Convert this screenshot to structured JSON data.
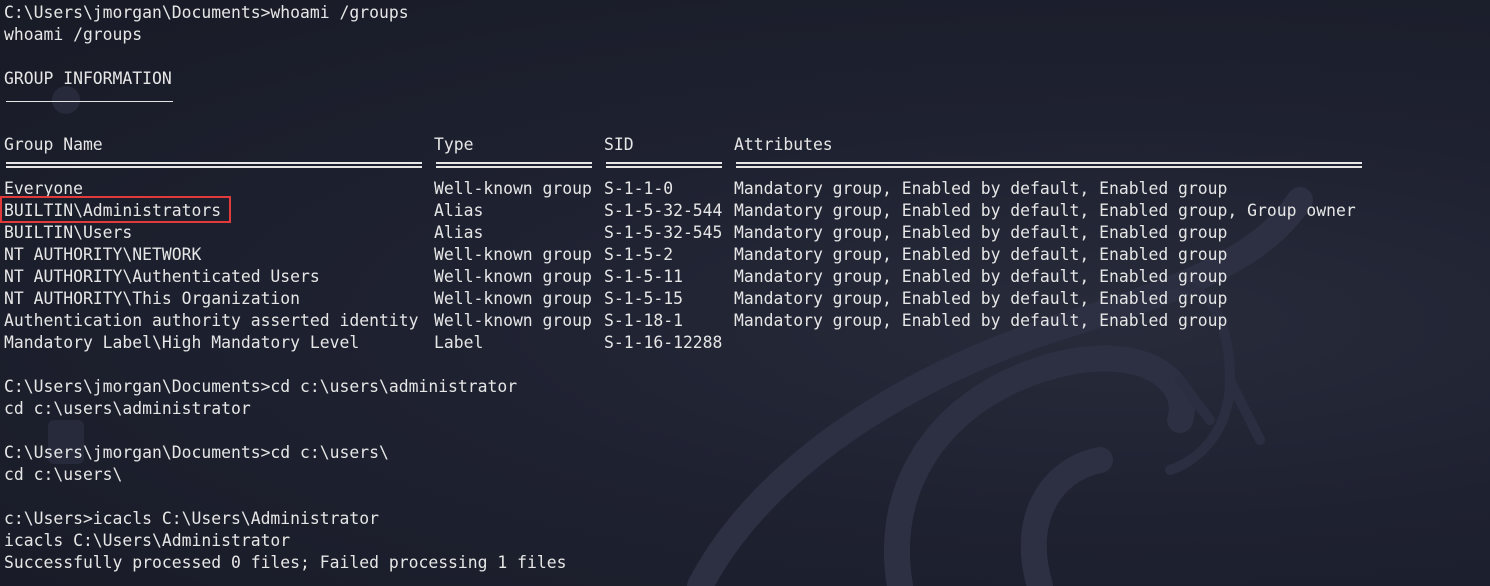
{
  "session": {
    "line1": "C:\\Users\\jmorgan\\Documents>whoami /groups",
    "line2": "whoami /groups",
    "section_title": "GROUP INFORMATION"
  },
  "table": {
    "headers": [
      "Group Name",
      "Type",
      "SID",
      "Attributes"
    ],
    "rows": [
      [
        "Everyone",
        "Well-known group",
        "S-1-1-0",
        "Mandatory group, Enabled by default, Enabled group"
      ],
      [
        "BUILTIN\\Administrators",
        "Alias",
        "S-1-5-32-544",
        "Mandatory group, Enabled by default, Enabled group, Group owner"
      ],
      [
        "BUILTIN\\Users",
        "Alias",
        "S-1-5-32-545",
        "Mandatory group, Enabled by default, Enabled group"
      ],
      [
        "NT AUTHORITY\\NETWORK",
        "Well-known group",
        "S-1-5-2",
        "Mandatory group, Enabled by default, Enabled group"
      ],
      [
        "NT AUTHORITY\\Authenticated Users",
        "Well-known group",
        "S-1-5-11",
        "Mandatory group, Enabled by default, Enabled group"
      ],
      [
        "NT AUTHORITY\\This Organization",
        "Well-known group",
        "S-1-5-15",
        "Mandatory group, Enabled by default, Enabled group"
      ],
      [
        "Authentication authority asserted identity",
        "Well-known group",
        "S-1-18-1",
        "Mandatory group, Enabled by default, Enabled group"
      ],
      [
        "Mandatory Label\\High Mandatory Level",
        "Label",
        "S-1-16-12288",
        ""
      ]
    ],
    "highlighted_row": 1
  },
  "commands": {
    "cd_admin_prompt": "C:\\Users\\jmorgan\\Documents>cd c:\\users\\administrator",
    "cd_admin_echo": "cd c:\\users\\administrator",
    "cd_users_prompt": "C:\\Users\\jmorgan\\Documents>cd c:\\users\\",
    "cd_users_echo": "cd c:\\users\\",
    "icacls_prompt": "c:\\Users>icacls C:\\Users\\Administrator",
    "icacls_echo": "icacls C:\\Users\\Administrator",
    "icacls_result": "Successfully processed 0 files; Failed processing 1 files"
  },
  "colors": {
    "background": "#1e2130",
    "text": "#e6e6e6",
    "highlight_border": "#e03a3a"
  },
  "icons": [
    "kali-dragon-watermark-icon"
  ]
}
